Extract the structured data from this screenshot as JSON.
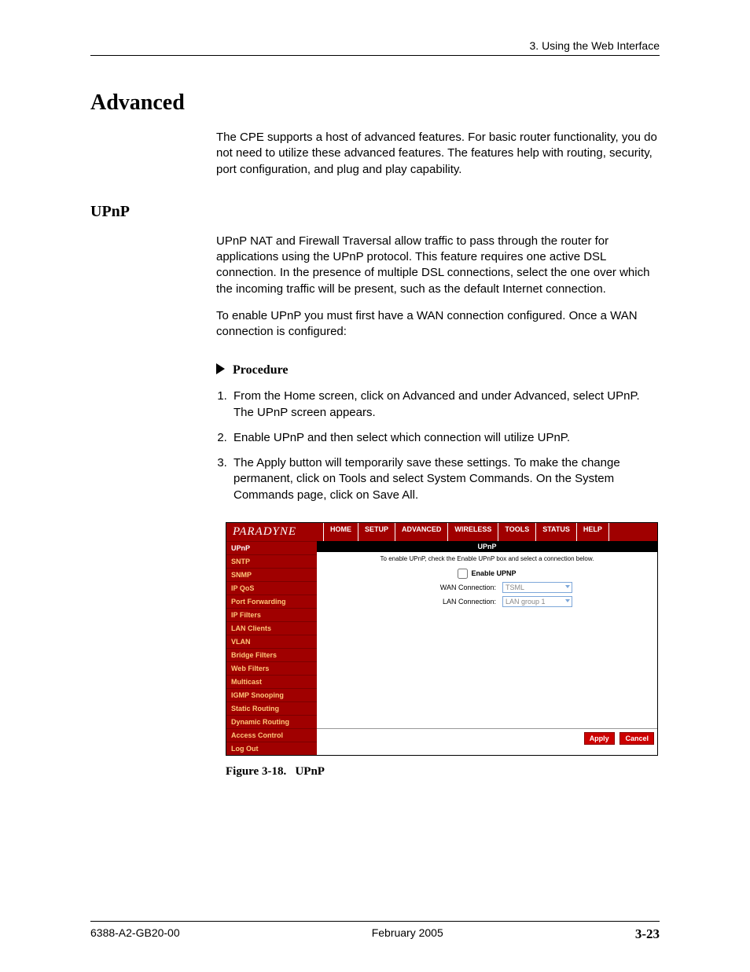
{
  "header": {
    "chapter": "3. Using the Web Interface"
  },
  "section": {
    "title": "Advanced",
    "intro": "The CPE supports a host of advanced features. For basic router functionality, you do not need to utilize these advanced features. The features help with routing, security, port configuration, and plug and play capability."
  },
  "upnp": {
    "title": "UPnP",
    "p1": "UPnP NAT and Firewall Traversal allow traffic to pass through the router for applications using the UPnP protocol. This feature requires one active DSL connection. In the presence of multiple DSL connections, select the one over which the incoming traffic will be present, such as the default Internet connection.",
    "p2": "To enable UPnP you must first have a WAN connection configured. Once a WAN connection is configured:",
    "procedure_label": "Procedure",
    "steps": [
      "From the Home screen, click on Advanced and under Advanced, select UPnP. The UPnP screen appears.",
      "Enable UPnP and then select which connection will utilize UPnP.",
      "The Apply button will temporarily save these settings. To make the change permanent, click on Tools and select System Commands. On the System Commands page, click on Save All."
    ]
  },
  "router": {
    "logo": "PARADYNE",
    "tabs": [
      "HOME",
      "SETUP",
      "ADVANCED",
      "WIRELESS",
      "TOOLS",
      "STATUS",
      "HELP"
    ],
    "sidebar": [
      "UPnP",
      "SNTP",
      "SNMP",
      "IP QoS",
      "Port Forwarding",
      "IP Filters",
      "LAN Clients",
      "VLAN",
      "Bridge Filters",
      "Web Filters",
      "Multicast",
      "IGMP Snooping",
      "Static Routing",
      "Dynamic Routing",
      "Access Control",
      "Log Out"
    ],
    "pane_title": "UPnP",
    "note": "To enable UPnP, check the Enable UPnP box and select a connection below.",
    "enable_label": "Enable UPNP",
    "wan_label": "WAN Connection:",
    "wan_value": "TSML",
    "lan_label": "LAN Connection:",
    "lan_value": "LAN group 1",
    "apply": "Apply",
    "cancel": "Cancel"
  },
  "figure": {
    "label": "Figure 3-18.",
    "title": "UPnP"
  },
  "footer": {
    "doc": "6388-A2-GB20-00",
    "date": "February 2005",
    "page": "3-23"
  }
}
